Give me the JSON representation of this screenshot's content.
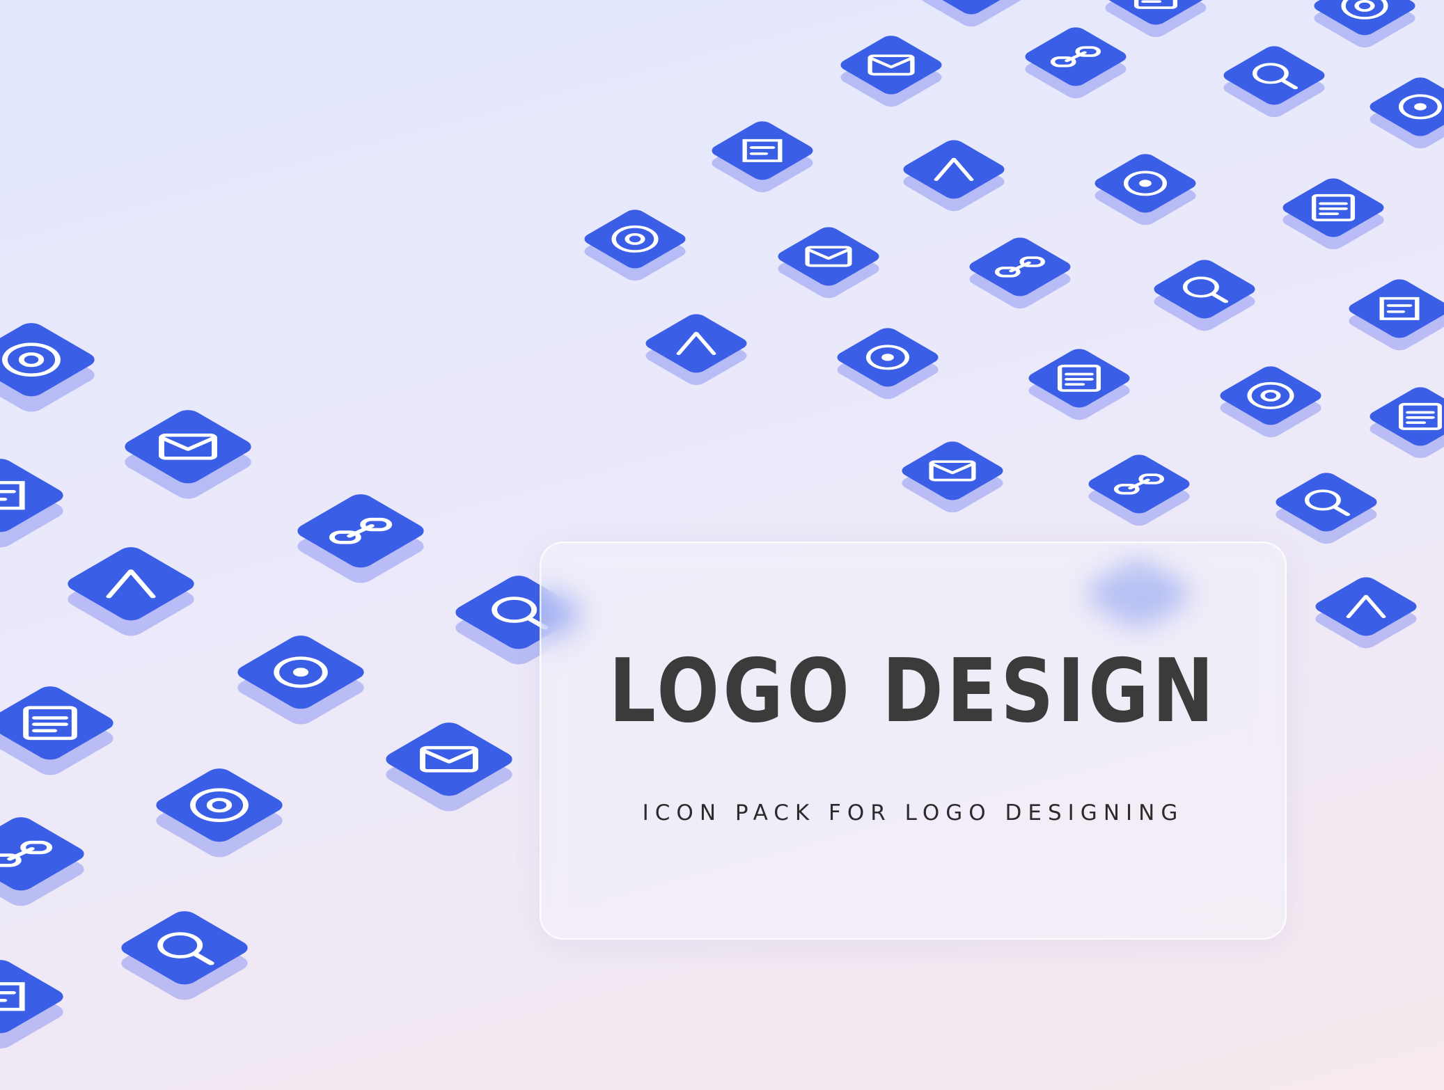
{
  "title": "LOGO DESIGN",
  "subtitle": "ICON PACK FOR LOGO DESIGNING",
  "colors": {
    "icon_tile": "#3a5ee6",
    "icon_shadow": "#8f98f3",
    "icon_glyph": "#ffffff",
    "title_text": "#3b3b3b",
    "background_top": "#e2e8fd",
    "background_bottom": "#f6e9ef"
  },
  "icons": [
    "link-icon",
    "document-edit-icon",
    "at-sign-icon",
    "email-check-icon",
    "chain-link-icon",
    "search-flash-icon",
    "document-icon",
    "user-rating-icon",
    "newsletter-icon",
    "support-agent-icon",
    "chat-bubble-icon",
    "user-circle-icon",
    "world-mail-icon",
    "add-contact-icon",
    "user-direction-icon",
    "email-edit-icon",
    "robot-icon",
    "signature-icon",
    "form-submit-icon",
    "email-send-icon",
    "email-icon",
    "call-sync-icon",
    "at-circle-icon",
    "message-chat-icon",
    "add-circle-icon",
    "team-network-icon",
    "download-inbox-icon",
    "message-box-icon",
    "contact-card-icon",
    "email-open-icon",
    "chat-dots-icon",
    "email-forward-icon",
    "handshake-icon",
    "at-symbol-icon",
    "list-upload-icon",
    "phone-sync-icon",
    "document-stack-icon"
  ]
}
